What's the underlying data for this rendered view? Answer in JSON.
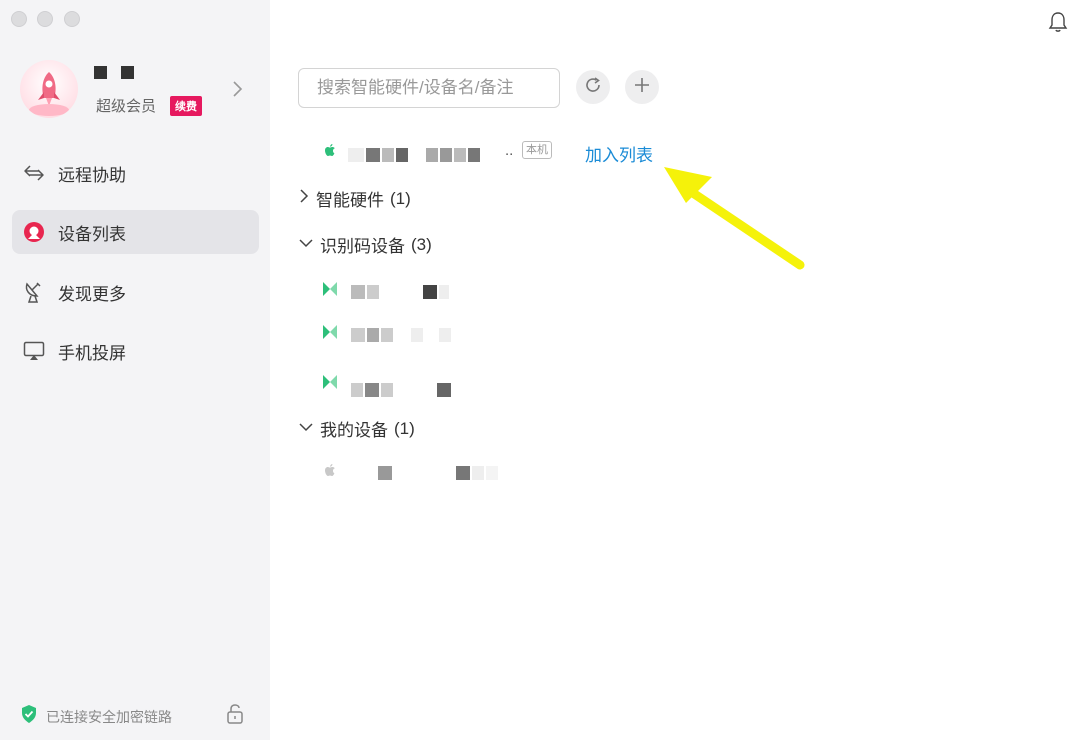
{
  "window": {
    "controls": [
      "close",
      "minimize",
      "zoom"
    ]
  },
  "user": {
    "membership": "超级会员",
    "renew_badge": "续费"
  },
  "sidebar": {
    "items": [
      {
        "label": "远程协助",
        "icon": "remote-assist-icon"
      },
      {
        "label": "设备列表",
        "icon": "device-list-icon",
        "active": true
      },
      {
        "label": "发现更多",
        "icon": "satellite-dish-icon"
      },
      {
        "label": "手机投屏",
        "icon": "screen-cast-icon"
      }
    ],
    "footer_text": "已连接安全加密链路"
  },
  "search": {
    "placeholder": "搜索智能硬件/设备名/备注"
  },
  "current_device": {
    "ellipsis": "..",
    "local_badge": "本机",
    "add_label": "加入列表"
  },
  "groups": [
    {
      "label": "智能硬件",
      "count": "(1)",
      "expanded": false
    },
    {
      "label": "识别码设备",
      "count": "(3)",
      "expanded": true
    },
    {
      "label": "我的设备",
      "count": "(1)",
      "expanded": true
    }
  ],
  "colors": {
    "accent": "#1a8bd6",
    "renew": "#e6195f",
    "device_green": "#2dbf7a",
    "annotation_arrow": "#f5f20a"
  }
}
